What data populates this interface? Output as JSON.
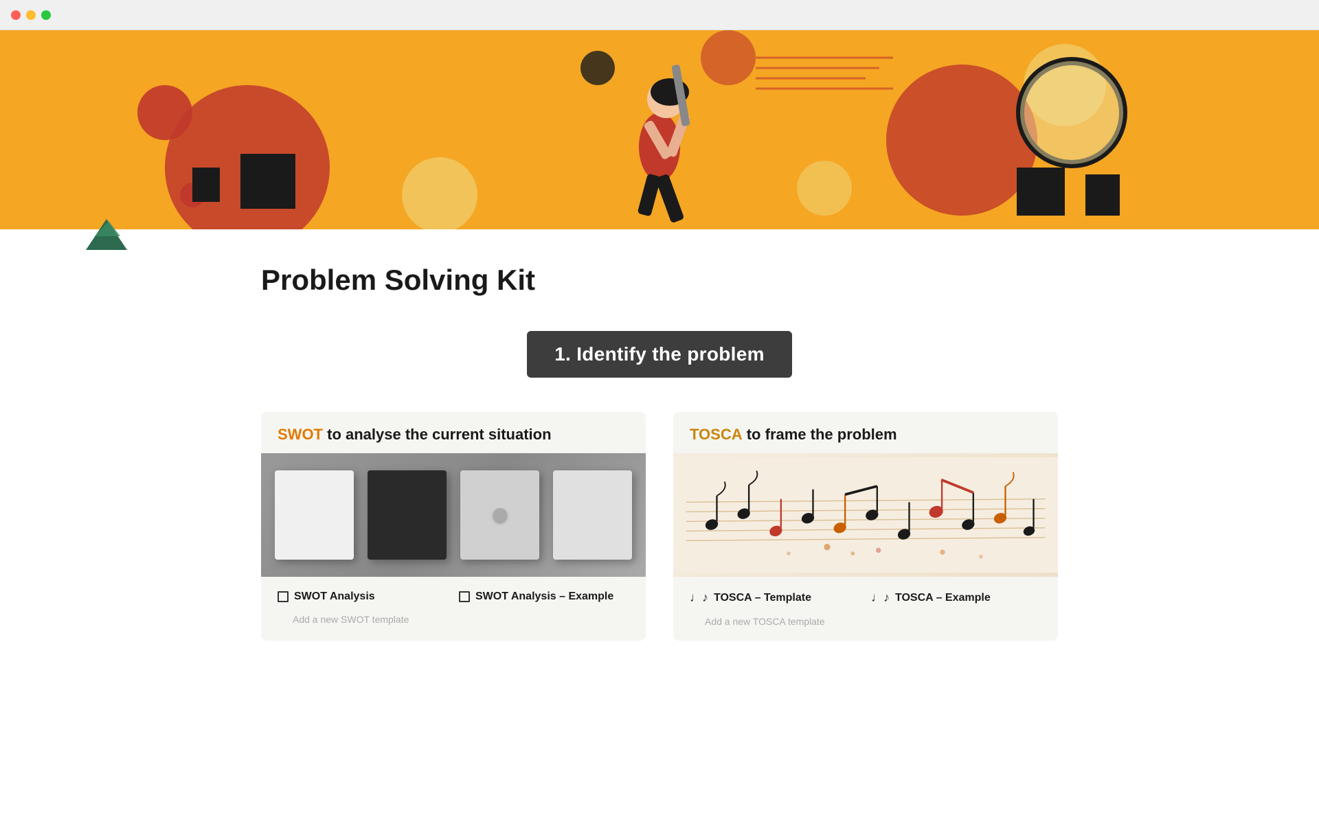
{
  "window": {
    "traffic_lights": [
      "red",
      "yellow",
      "green"
    ]
  },
  "hero": {
    "bg_color": "#f5a623"
  },
  "page": {
    "title": "Problem Solving Kit",
    "section_badge": "1. Identify the problem"
  },
  "cards": [
    {
      "id": "swot",
      "accent_text": "SWOT",
      "rest_text": " to analyse the current situation",
      "accent_color": "#e07b00",
      "items": [
        {
          "icon": "doc",
          "title": "SWOT Analysis",
          "subtitle": ""
        },
        {
          "icon": "doc",
          "title": "SWOT Analysis – Example",
          "subtitle": ""
        },
        {
          "icon": "",
          "title": "",
          "subtitle": "Add a new SWOT template"
        },
        {
          "icon": "",
          "title": "",
          "subtitle": ""
        }
      ]
    },
    {
      "id": "tosca",
      "accent_text": "TOSCA",
      "rest_text": " to frame the problem",
      "accent_color": "#c8860a",
      "items": [
        {
          "icon": "music",
          "title": "TOSCA – Template",
          "subtitle": ""
        },
        {
          "icon": "music",
          "title": "TOSCA – Example",
          "subtitle": ""
        },
        {
          "icon": "",
          "title": "",
          "subtitle": "Add a new TOSCA template"
        },
        {
          "icon": "",
          "title": "",
          "subtitle": ""
        }
      ]
    }
  ],
  "labels": {
    "swot_analysis": "SWOT Analysis",
    "swot_example": "SWOT Analysis – Example",
    "swot_add": "Add a new SWOT template",
    "tosca_template": "TOSCA – Template",
    "tosca_example": "TOSCA – Example",
    "tosca_add": "Add a new TOSCA template"
  }
}
